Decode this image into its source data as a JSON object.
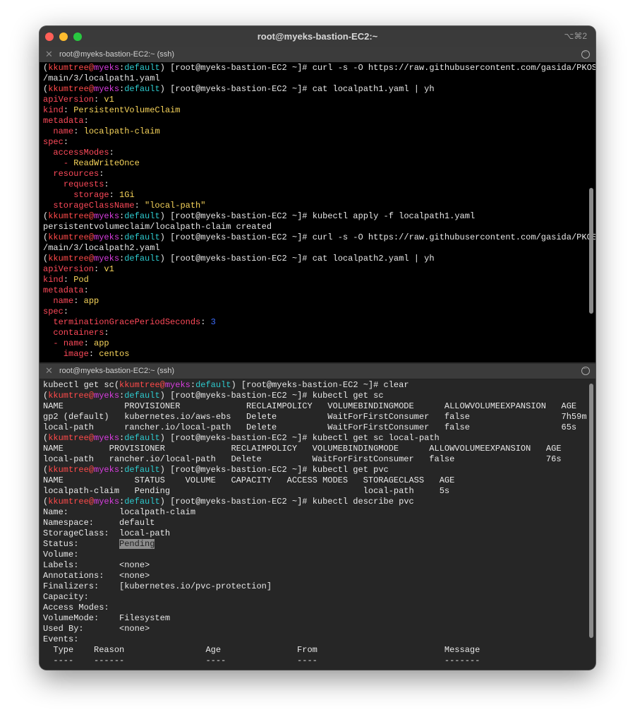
{
  "window": {
    "title": "root@myeks-bastion-EC2:~",
    "shortcut": "⌥⌘2"
  },
  "pane1": {
    "tab_title": "root@myeks-bastion-EC2:~ (ssh)",
    "prompt": {
      "user": "kkumtree",
      "host": "myeks",
      "ns": "default",
      "cwd": "[root@myeks-bastion-EC2 ~]#"
    },
    "lines": [
      {
        "t": "prompt",
        "cmd": " curl -s -O https://raw.githubusercontent.com/gasida/PKOS"
      },
      {
        "t": "plain",
        "text": "/main/3/localpath1.yaml"
      },
      {
        "t": "prompt",
        "cmd": " cat localpath1.yaml | yh"
      },
      {
        "t": "kv",
        "indent": "",
        "key": "apiVersion",
        "val": "v1",
        "vt": "str"
      },
      {
        "t": "kv",
        "indent": "",
        "key": "kind",
        "val": "PersistentVolumeClaim",
        "vt": "str"
      },
      {
        "t": "kv",
        "indent": "",
        "key": "metadata",
        "val": "",
        "vt": "str"
      },
      {
        "t": "kv",
        "indent": "  ",
        "key": "name",
        "val": "localpath-claim",
        "vt": "str"
      },
      {
        "t": "kv",
        "indent": "",
        "key": "spec",
        "val": "",
        "vt": "str"
      },
      {
        "t": "kv",
        "indent": "  ",
        "key": "accessModes",
        "val": "",
        "vt": "str"
      },
      {
        "t": "item",
        "indent": "    ",
        "val": "ReadWriteOnce"
      },
      {
        "t": "kv",
        "indent": "  ",
        "key": "resources",
        "val": "",
        "vt": "str"
      },
      {
        "t": "kv",
        "indent": "    ",
        "key": "requests",
        "val": "",
        "vt": "str"
      },
      {
        "t": "kv",
        "indent": "      ",
        "key": "storage",
        "val": "1Gi",
        "vt": "str"
      },
      {
        "t": "kv",
        "indent": "  ",
        "key": "storageClassName",
        "val": "\"local-path\"",
        "vt": "str"
      },
      {
        "t": "prompt",
        "cmd": " kubectl apply -f localpath1.yaml"
      },
      {
        "t": "plain",
        "text": "persistentvolumeclaim/localpath-claim created"
      },
      {
        "t": "prompt",
        "cmd": " curl -s -O https://raw.githubusercontent.com/gasida/PKOS"
      },
      {
        "t": "plain",
        "text": "/main/3/localpath2.yaml"
      },
      {
        "t": "prompt",
        "cmd": " cat localpath2.yaml | yh"
      },
      {
        "t": "kv",
        "indent": "",
        "key": "apiVersion",
        "val": "v1",
        "vt": "str"
      },
      {
        "t": "kv",
        "indent": "",
        "key": "kind",
        "val": "Pod",
        "vt": "str"
      },
      {
        "t": "kv",
        "indent": "",
        "key": "metadata",
        "val": "",
        "vt": "str"
      },
      {
        "t": "kv",
        "indent": "  ",
        "key": "name",
        "val": "app",
        "vt": "str"
      },
      {
        "t": "kv",
        "indent": "",
        "key": "spec",
        "val": "",
        "vt": "str"
      },
      {
        "t": "kv",
        "indent": "  ",
        "key": "terminationGracePeriodSeconds",
        "val": "3",
        "vt": "num"
      },
      {
        "t": "kv",
        "indent": "  ",
        "key": "containers",
        "val": "",
        "vt": "str"
      },
      {
        "t": "item",
        "indent": "  ",
        "key": "name",
        "val": "app"
      },
      {
        "t": "kv",
        "indent": "    ",
        "key": "image",
        "val": "centos",
        "vt": "str"
      }
    ]
  },
  "pane2": {
    "tab_title": "root@myeks-bastion-EC2:~ (ssh)",
    "prompt": {
      "user": "kkumtree",
      "host": "myeks",
      "ns": "default",
      "cwd": "[root@myeks-bastion-EC2 ~]#"
    },
    "lines": [
      {
        "t": "mixed",
        "pre": "kubectl get sc",
        "cmd": " clear"
      },
      {
        "t": "prompt",
        "cmd": " kubectl get sc"
      },
      {
        "t": "plain",
        "text": "NAME            PROVISIONER             RECLAIMPOLICY   VOLUMEBINDINGMODE      ALLOWVOLUMEEXPANSION   AGE"
      },
      {
        "t": "plain",
        "text": "gp2 (default)   kubernetes.io/aws-ebs   Delete          WaitForFirstConsumer   false                  7h59m"
      },
      {
        "t": "plain",
        "text": "local-path      rancher.io/local-path   Delete          WaitForFirstConsumer   false                  65s"
      },
      {
        "t": "prompt",
        "cmd": " kubectl get sc local-path"
      },
      {
        "t": "plain",
        "text": "NAME         PROVISIONER             RECLAIMPOLICY   VOLUMEBINDINGMODE      ALLOWVOLUMEEXPANSION   AGE"
      },
      {
        "t": "plain",
        "text": "local-path   rancher.io/local-path   Delete          WaitForFirstConsumer   false                  76s"
      },
      {
        "t": "prompt",
        "cmd": " kubectl get pvc"
      },
      {
        "t": "plain",
        "text": "NAME              STATUS    VOLUME   CAPACITY   ACCESS MODES   STORAGECLASS   AGE"
      },
      {
        "t": "plain",
        "text": "localpath-claim   Pending                                      local-path     5s"
      },
      {
        "t": "prompt",
        "cmd": " kubectl describe pvc"
      },
      {
        "t": "plain",
        "text": "Name:          localpath-claim"
      },
      {
        "t": "plain",
        "text": "Namespace:     default"
      },
      {
        "t": "plain",
        "text": "StorageClass:  local-path"
      },
      {
        "t": "hl",
        "pre": "Status:        ",
        "hl": "Pending"
      },
      {
        "t": "plain",
        "text": "Volume:"
      },
      {
        "t": "plain",
        "text": "Labels:        <none>"
      },
      {
        "t": "plain",
        "text": "Annotations:   <none>"
      },
      {
        "t": "plain",
        "text": "Finalizers:    [kubernetes.io/pvc-protection]"
      },
      {
        "t": "plain",
        "text": "Capacity:"
      },
      {
        "t": "plain",
        "text": "Access Modes:"
      },
      {
        "t": "plain",
        "text": "VolumeMode:    Filesystem"
      },
      {
        "t": "plain",
        "text": "Used By:       <none>"
      },
      {
        "t": "plain",
        "text": "Events:"
      },
      {
        "t": "plain",
        "text": "  Type    Reason                Age               From                         Message"
      },
      {
        "t": "plain",
        "text": "  ----    ------                ----              ----                         -------"
      }
    ]
  }
}
